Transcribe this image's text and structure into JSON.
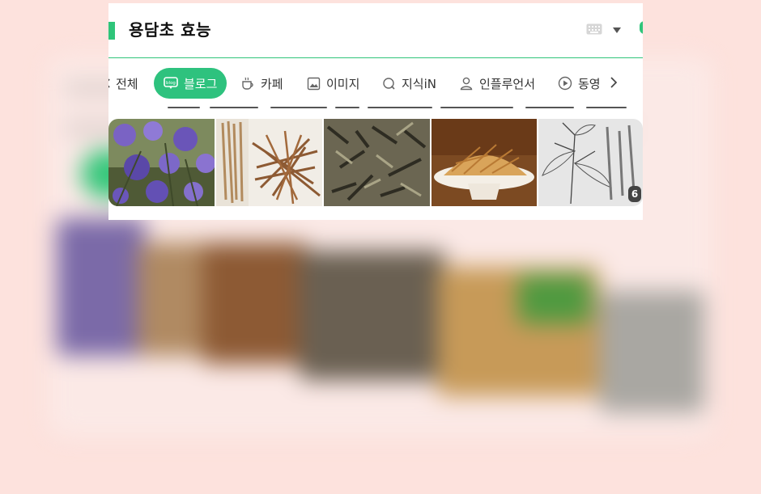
{
  "search": {
    "query": "용담초 효능"
  },
  "tabs": [
    {
      "label": "전체",
      "icon": "all-icon",
      "active": false
    },
    {
      "label": "블로그",
      "icon": "blog-icon",
      "active": true
    },
    {
      "label": "카페",
      "icon": "cafe-icon",
      "active": false
    },
    {
      "label": "이미지",
      "icon": "image-icon",
      "active": false
    },
    {
      "label": "지식iN",
      "icon": "knowledge-icon",
      "active": false
    },
    {
      "label": "인플루언서",
      "icon": "influencer-icon",
      "active": false
    },
    {
      "label": "동영",
      "icon": "video-icon",
      "active": false
    }
  ],
  "gallery": {
    "images": [
      {
        "name": "purple-gentian-flowers",
        "desc_color": "#6b5bb0"
      },
      {
        "name": "dried-root-bundle",
        "desc_color": "#a9743f"
      },
      {
        "name": "dried-herb-leaves",
        "desc_color": "#5d5a45"
      },
      {
        "name": "dried-roots-on-plate",
        "desc_color": "#c98a3e"
      },
      {
        "name": "botanical-drawing",
        "desc_color": "#cfcfcf"
      }
    ],
    "more_count": "6"
  },
  "colors": {
    "accent": "#2ec27e",
    "background": "#fde2dd"
  }
}
